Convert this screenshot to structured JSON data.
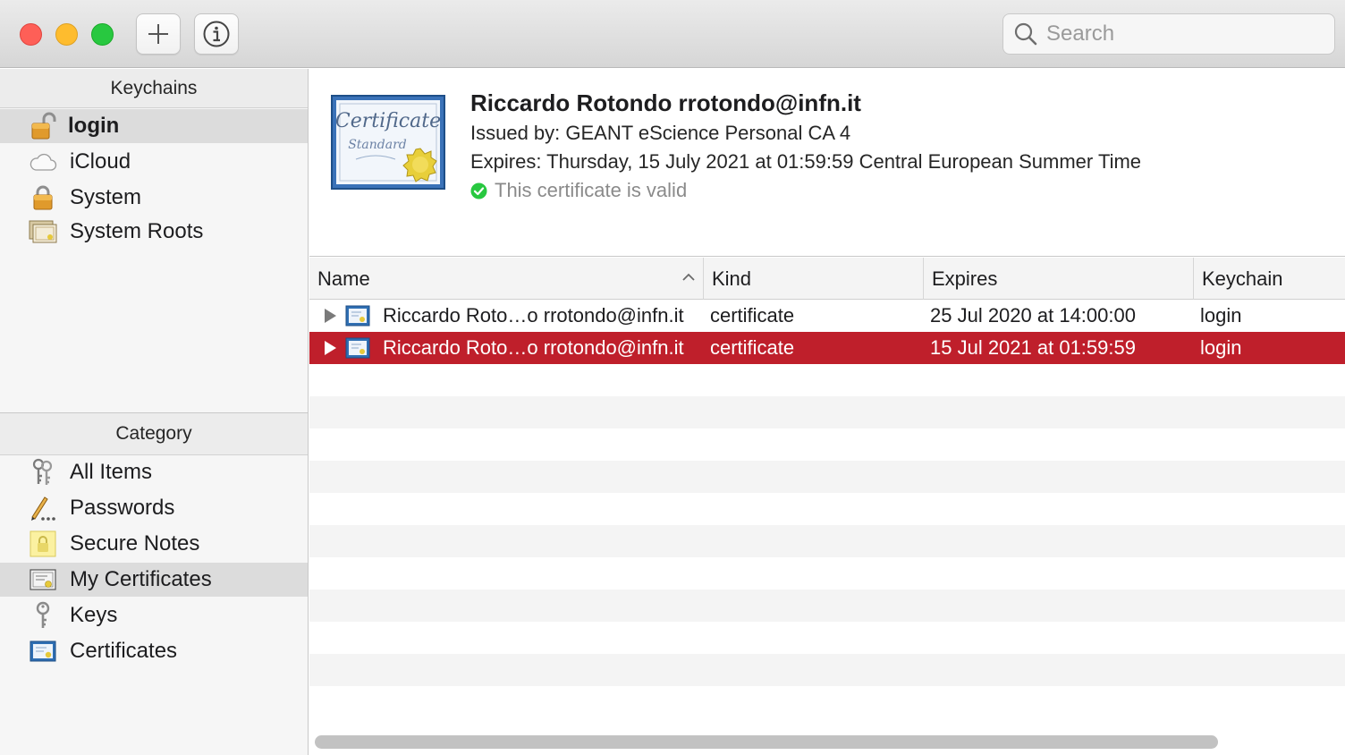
{
  "toolbar": {
    "search": {
      "placeholder": "Search"
    }
  },
  "sidebar": {
    "keychains_header": "Keychains",
    "keychains": [
      {
        "label": "login",
        "icon": "unlocked-padlock-icon",
        "selected": true
      },
      {
        "label": "iCloud",
        "icon": "cloud-icon",
        "selected": false
      },
      {
        "label": "System",
        "icon": "padlock-icon",
        "selected": false
      },
      {
        "label": "System Roots",
        "icon": "certificate-stack-icon",
        "selected": false
      }
    ],
    "category_header": "Category",
    "categories": [
      {
        "label": "All Items",
        "icon": "keys-icon",
        "selected": false
      },
      {
        "label": "Passwords",
        "icon": "pencil-dots-icon",
        "selected": false
      },
      {
        "label": "Secure Notes",
        "icon": "note-lock-icon",
        "selected": false
      },
      {
        "label": "My Certificates",
        "icon": "my-certificate-icon",
        "selected": true
      },
      {
        "label": "Keys",
        "icon": "key-icon",
        "selected": false
      },
      {
        "label": "Certificates",
        "icon": "certificate-icon",
        "selected": false
      }
    ]
  },
  "detail": {
    "title": "Riccardo Rotondo rrotondo@infn.it",
    "issued_by": "Issued by: GEANT eScience Personal CA 4",
    "expires": "Expires: Thursday, 15 July 2021 at 01:59:59 Central European Summer Time",
    "validity": "This certificate is valid",
    "cert_word_1": "Certificate",
    "cert_word_2": "Standard"
  },
  "table": {
    "columns": {
      "name": "Name",
      "kind": "Kind",
      "expires": "Expires",
      "keychain": "Keychain"
    },
    "rows": [
      {
        "name": "Riccardo Roto…o rrotondo@infn.it",
        "kind": "certificate",
        "expires": "25 Jul 2020 at 14:00:00",
        "keychain": "login",
        "selected": false
      },
      {
        "name": "Riccardo Roto…o rrotondo@infn.it",
        "kind": "certificate",
        "expires": "15 Jul 2021 at 01:59:59",
        "keychain": "login",
        "selected": true
      }
    ]
  },
  "colors": {
    "selection": "#bf1f2b",
    "valid_green": "#28c840"
  }
}
